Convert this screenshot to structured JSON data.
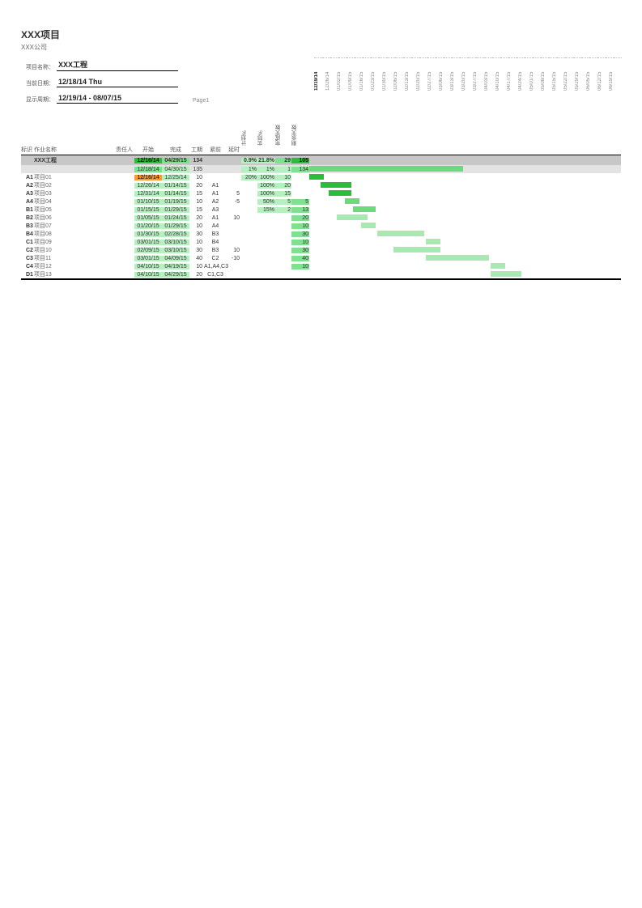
{
  "header": {
    "title": "XXX项目",
    "company": "XXX公司",
    "labels": {
      "project": "项目名称：",
      "date": "当前日期：",
      "period": "显示周期：",
      "page": "Page1"
    },
    "project_name": "XXX工程",
    "current_date": "12/18/14 Thu",
    "display_period": "12/19/14 - 08/07/15"
  },
  "columns": {
    "id": "标识",
    "name": "作业名称",
    "resp": "责任人",
    "start": "开始",
    "end": "完成",
    "dur": "工期",
    "pred": "紧前",
    "dly": "延时",
    "plan": "计划%",
    "act": "实际%",
    "days": "完成天数",
    "rem": "剩余天数"
  },
  "gantt_dates": [
    "12/19/14",
    "12/26/14",
    "01/02/15",
    "01/09/15",
    "01/16/15",
    "01/23/15",
    "01/30/15",
    "02/06/15",
    "02/13/15",
    "02/20/15",
    "02/27/15",
    "03/06/15",
    "03/13/15",
    "03/20/15",
    "03/27/15",
    "04/03/15",
    "04/10/15",
    "04/17/15",
    "04/24/15",
    "05/01/15",
    "05/08/15",
    "05/15/15",
    "05/22/15",
    "05/29/15",
    "06/05/15",
    "06/12/15",
    "06/19/15"
  ],
  "summary_main": {
    "name": "XXX工程",
    "start": "12/16/14",
    "end": "04/29/15",
    "dur": "134",
    "plan": "0.9%",
    "act": "21.8%",
    "days": "29",
    "rem": "105"
  },
  "summary_sub": {
    "start": "12/18/14",
    "end": "04/30/15",
    "dur": "135",
    "plan": "1%",
    "act": "1%",
    "days": "1",
    "rem": "134"
  },
  "rows": [
    {
      "id": "A1",
      "name": "项目01",
      "start": "12/16/14",
      "end": "12/25/14",
      "dur": "10",
      "pred": "",
      "dly": "",
      "plan": "20%",
      "act": "100%",
      "days": "10",
      "rem": "",
      "start_hl": "orange"
    },
    {
      "id": "A2",
      "name": "项目02",
      "start": "12/26/14",
      "end": "01/14/15",
      "dur": "20",
      "pred": "A1",
      "dly": "",
      "plan": "",
      "act": "100%",
      "days": "20",
      "rem": ""
    },
    {
      "id": "A3",
      "name": "项目03",
      "start": "12/31/14",
      "end": "01/14/15",
      "dur": "15",
      "pred": "A1",
      "dly": "5",
      "plan": "",
      "act": "100%",
      "days": "15",
      "rem": ""
    },
    {
      "id": "A4",
      "name": "项目04",
      "start": "01/10/15",
      "end": "01/19/15",
      "dur": "10",
      "pred": "A2",
      "dly": "-5",
      "plan": "",
      "act": "50%",
      "days": "5",
      "rem": "5"
    },
    {
      "id": "B1",
      "name": "项目05",
      "start": "01/15/15",
      "end": "01/29/15",
      "dur": "15",
      "pred": "A3",
      "dly": "",
      "plan": "",
      "act": "15%",
      "days": "2",
      "rem": "13"
    },
    {
      "id": "B2",
      "name": "项目06",
      "start": "01/05/15",
      "end": "01/24/15",
      "dur": "20",
      "pred": "A1",
      "dly": "10",
      "plan": "",
      "act": "",
      "days": "",
      "rem": "20"
    },
    {
      "id": "B3",
      "name": "项目07",
      "start": "01/20/15",
      "end": "01/29/15",
      "dur": "10",
      "pred": "A4",
      "dly": "",
      "plan": "",
      "act": "",
      "days": "",
      "rem": "10"
    },
    {
      "id": "B4",
      "name": "项目08",
      "start": "01/30/15",
      "end": "02/28/15",
      "dur": "30",
      "pred": "B3",
      "dly": "",
      "plan": "",
      "act": "",
      "days": "",
      "rem": "30"
    },
    {
      "id": "C1",
      "name": "项目09",
      "start": "03/01/15",
      "end": "03/10/15",
      "dur": "10",
      "pred": "B4",
      "dly": "",
      "plan": "",
      "act": "",
      "days": "",
      "rem": "10"
    },
    {
      "id": "C2",
      "name": "项目10",
      "start": "02/09/15",
      "end": "03/10/15",
      "dur": "30",
      "pred": "B3",
      "dly": "10",
      "plan": "",
      "act": "",
      "days": "",
      "rem": "30"
    },
    {
      "id": "C3",
      "name": "项目11",
      "start": "03/01/15",
      "end": "04/09/15",
      "dur": "40",
      "pred": "C2",
      "dly": "-10",
      "plan": "",
      "act": "",
      "days": "",
      "rem": "40"
    },
    {
      "id": "C4",
      "name": "项目12",
      "start": "04/10/15",
      "end": "04/19/15",
      "dur": "10",
      "pred": "A1,A4,C3",
      "dly": "",
      "plan": "",
      "act": "",
      "days": "",
      "rem": "10"
    },
    {
      "id": "D1",
      "name": "项目13",
      "start": "04/10/15",
      "end": "04/29/15",
      "dur": "20",
      "pred": "C1,C3",
      "dly": "",
      "plan": "",
      "act": "",
      "days": "",
      "rem": ""
    }
  ]
}
